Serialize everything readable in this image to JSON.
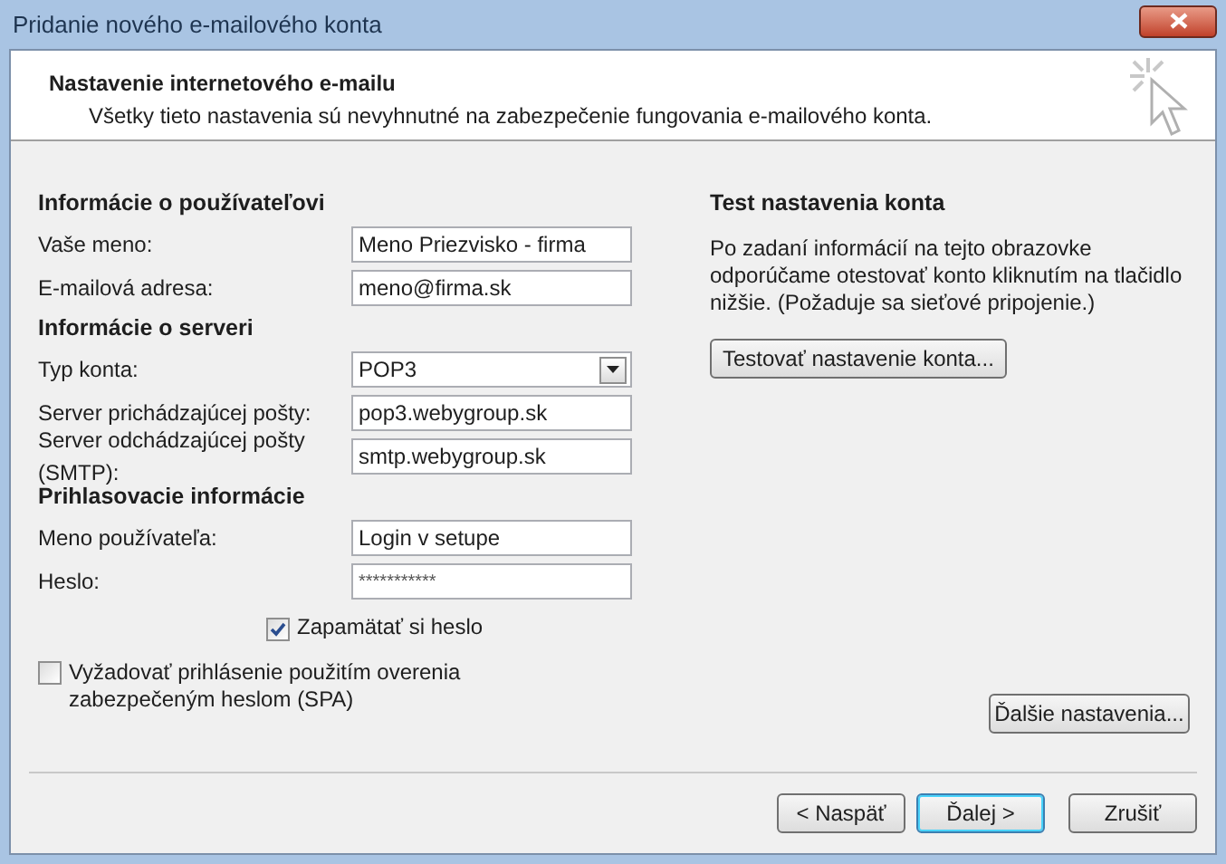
{
  "window": {
    "title": "Pridanie nového e-mailového konta"
  },
  "header": {
    "title": "Nastavenie internetového e-mailu",
    "subtitle": "Všetky tieto nastavenia sú nevyhnutné na zabezpečenie fungovania e-mailového konta."
  },
  "sections": [
    {
      "title": "Informácie o používateľovi",
      "fields": [
        {
          "kind": "text",
          "label": "Vaše meno:",
          "value": "Meno Priezvisko - firma"
        },
        {
          "kind": "text",
          "label": "E-mailová adresa:",
          "value": "meno@firma.sk"
        }
      ]
    },
    {
      "title": "Informácie o serveri",
      "fields": [
        {
          "kind": "select",
          "label": "Typ konta:",
          "value": "POP3"
        },
        {
          "kind": "text",
          "label": "Server prichádzajúcej pošty:",
          "value": "pop3.webygroup.sk"
        },
        {
          "kind": "text",
          "label": "Server odchádzajúcej pošty (SMTP):",
          "value": "smtp.webygroup.sk"
        }
      ]
    },
    {
      "title": "Prihlasovacie informácie",
      "fields": [
        {
          "kind": "text",
          "label": "Meno používateľa:",
          "value": "Login v setupe"
        },
        {
          "kind": "password",
          "label": "Heslo:",
          "value": "***********"
        }
      ]
    }
  ],
  "remember_password": {
    "label": "Zapamätať si heslo",
    "checked": true
  },
  "require_spa": {
    "label": "Vyžadovať prihlásenie použitím overenia zabezpečeným heslom (SPA)",
    "checked": false
  },
  "test": {
    "title": "Test nastavenia konta",
    "text": "Po zadaní informácií na tejto obrazovke odporúčame otestovať konto kliknutím na tlačidlo nižšie. (Požaduje sa sieťové pripojenie.)",
    "button": "Testovať nastavenie konta..."
  },
  "more_settings": "Ďalšie nastavenia...",
  "buttons": [
    {
      "label": "< Naspäť",
      "selected": false
    },
    {
      "label": "Ďalej >",
      "selected": true
    },
    {
      "label": "Zrušiť",
      "selected": false
    }
  ]
}
